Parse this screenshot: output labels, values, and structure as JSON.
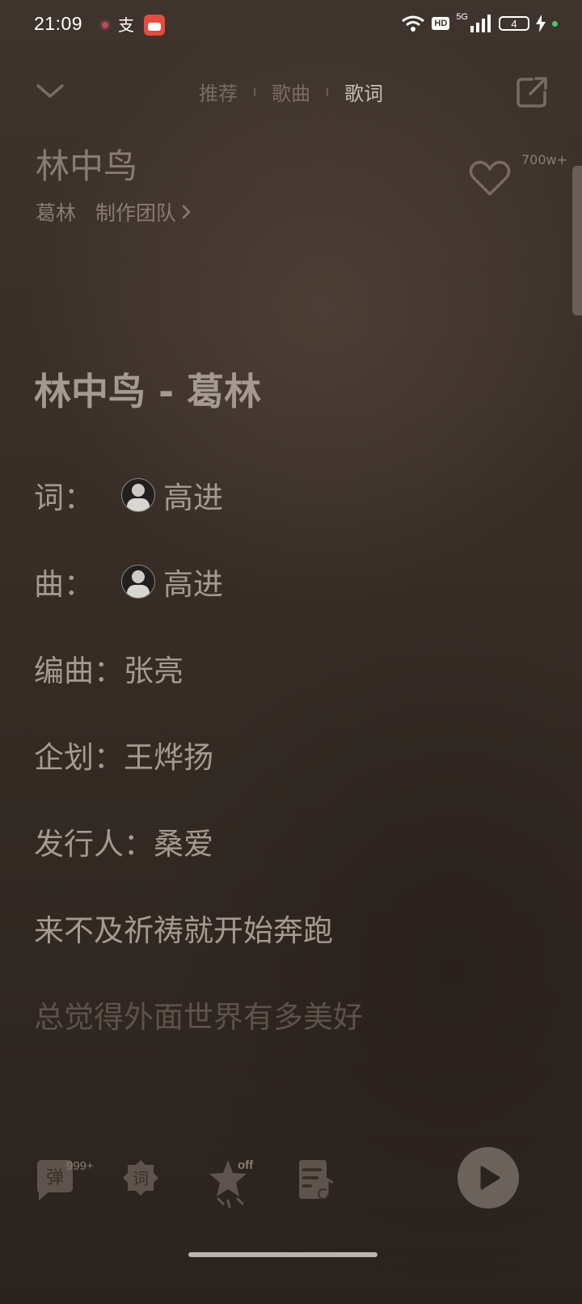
{
  "status_bar": {
    "time": "21:09",
    "alipay_glyph": "支",
    "hd": "HD",
    "network": "5G",
    "battery": "4"
  },
  "nav": {
    "tabs": [
      {
        "label": "推荐",
        "active": false
      },
      {
        "label": "歌曲",
        "active": false
      },
      {
        "label": "歌词",
        "active": true
      }
    ]
  },
  "song": {
    "title": "林中鸟",
    "artist": "葛林",
    "team_link": "制作团队",
    "like_count": "700w+"
  },
  "lyrics": {
    "head": "林中鸟 - 葛林",
    "credits": [
      {
        "label": "词：",
        "name": "高进",
        "avatar": true
      },
      {
        "label": "曲：",
        "name": "高进",
        "avatar": true
      },
      {
        "label": "编曲：",
        "name": "张亮",
        "avatar": false
      },
      {
        "label": "企划：",
        "name": "王烨扬",
        "avatar": false
      },
      {
        "label": "发行人：",
        "name": "桑爱",
        "avatar": false
      }
    ],
    "lines": [
      {
        "text": "来不及祈祷就开始奔跑",
        "dim": false
      },
      {
        "text": "总觉得外面世界有多美好",
        "dim": true
      }
    ]
  },
  "toolbar": {
    "danmu_glyph": "弹",
    "danmu_count": "999+",
    "ci_glyph": "词",
    "star_state": "off"
  },
  "icons": [
    "chevron-down-icon",
    "share-icon",
    "heart-icon",
    "chevron-right-icon",
    "danmu-icon",
    "lyrics-icon",
    "star-icon",
    "playlist-icon",
    "play-icon",
    "wifi-icon",
    "signal-icon",
    "battery-icon",
    "charging-icon"
  ],
  "colors": {
    "background": "#3a2f28",
    "text_primary": "#a69a90",
    "text_dim": "#5e524a",
    "accent_green": "#3ed06a"
  }
}
